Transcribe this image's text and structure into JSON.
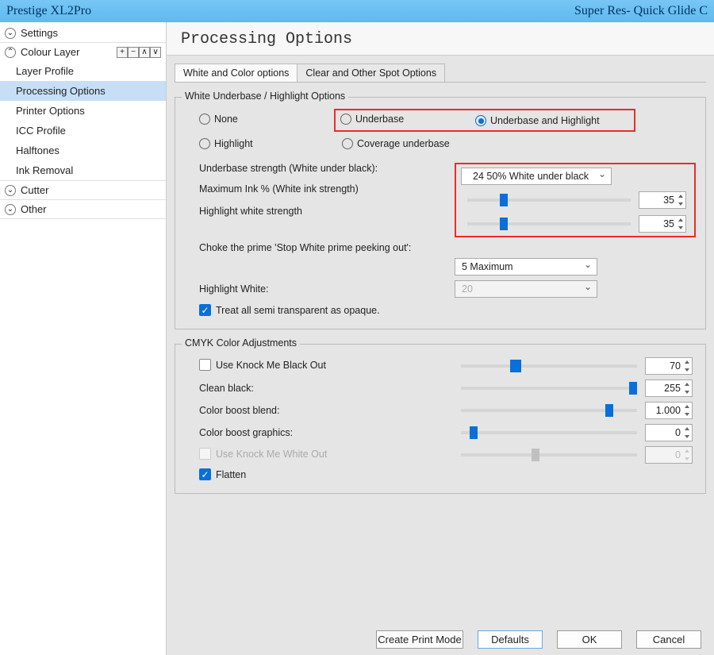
{
  "titlebar": {
    "left": "Prestige XL2Pro",
    "right": "Super Res- Quick Glide C"
  },
  "sidebar": {
    "settings": "Settings",
    "colour_layer": "Colour Layer",
    "items": [
      "Layer Profile",
      "Processing Options",
      "Printer Options",
      "ICC Profile",
      "Halftones",
      "Ink Removal"
    ],
    "cutter": "Cutter",
    "other": "Other"
  },
  "page_title": "Processing Options",
  "tabs": [
    "White and Color options",
    "Clear and Other Spot Options"
  ],
  "g1": {
    "title": "White Underbase / Highlight Options",
    "radios": {
      "none": "None",
      "underbase": "Underbase",
      "uh": "Underbase and Highlight",
      "highlight": "Highlight",
      "coverage": "Coverage underbase"
    },
    "strength_label": "Underbase strength (White under black):",
    "strength_select": "24 50% White under black",
    "maxink_label": "Maximum Ink % (White ink strength)",
    "maxink_val": "35",
    "hws_label": "Highlight white strength",
    "hws_val": "35",
    "choke_label": "Choke the prime 'Stop White prime peeking out':",
    "choke_select": "5 Maximum",
    "hw_label": "Highlight White:",
    "hw_select": "20",
    "treat_label": "Treat all semi transparent as opaque."
  },
  "g2": {
    "title": "CMYK Color Adjustments",
    "knock_black": "Use Knock Me Black Out",
    "knock_black_val": "70",
    "clean_label": "Clean black:",
    "clean_val": "255",
    "cbb_label": "Color boost blend:",
    "cbb_val": "1.000",
    "cbg_label": "Color boost graphics:",
    "cbg_val": "0",
    "knock_white": "Use Knock Me White Out",
    "knock_white_val": "0",
    "flatten": "Flatten"
  },
  "footer": {
    "create": "Create Print Mode",
    "defaults": "Defaults",
    "ok": "OK",
    "cancel": "Cancel"
  }
}
